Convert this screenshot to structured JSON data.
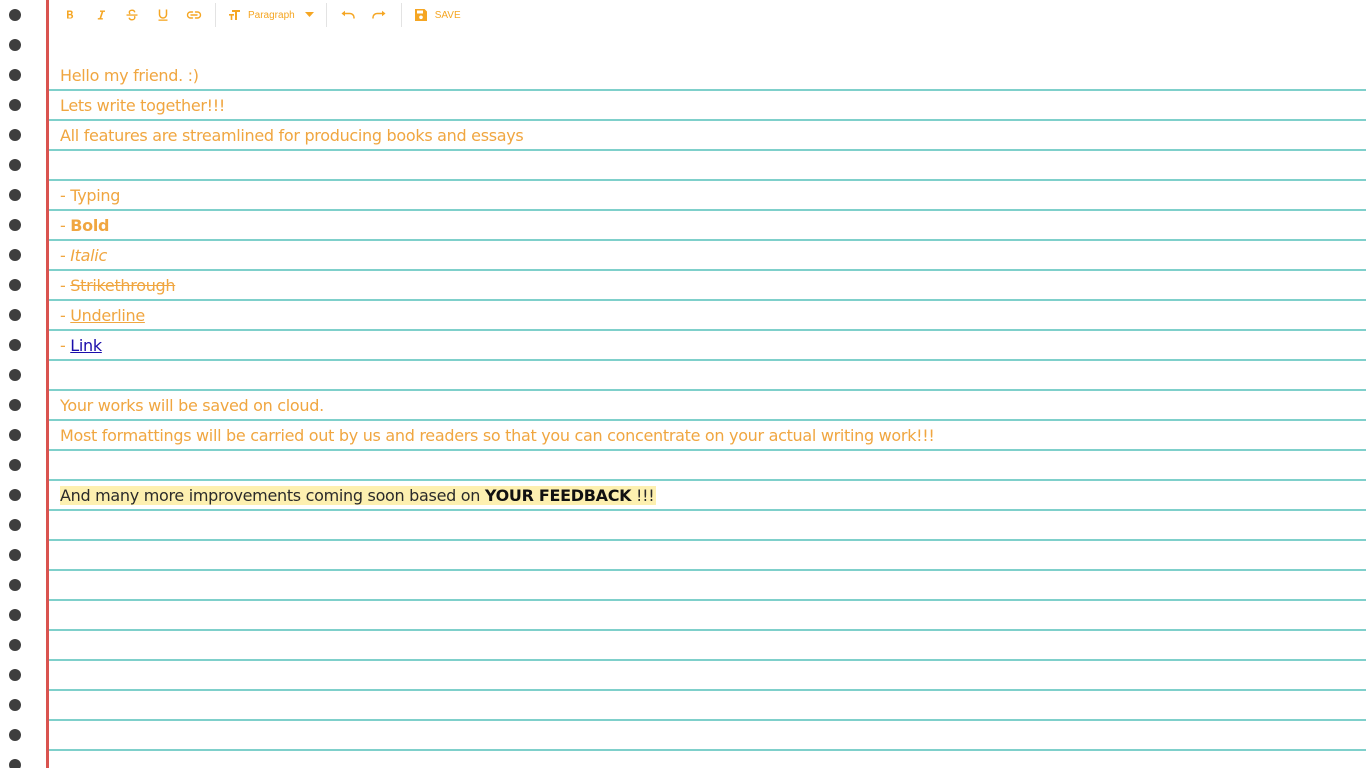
{
  "colors": {
    "accent": "#f5a623",
    "text": "#f0a640",
    "rule": "#7fd0cb",
    "margin": "#d9534f",
    "hole": "#3e3e3e",
    "highlight": "#fdf0b0",
    "link": "#1a0dab"
  },
  "toolbar": {
    "bold_icon": "bold-icon",
    "italic_icon": "italic-icon",
    "strike_icon": "strikethrough-icon",
    "underline_icon": "underline-icon",
    "link_icon": "link-icon",
    "paragraph_label": "Paragraph",
    "undo_icon": "undo-icon",
    "redo_icon": "redo-icon",
    "save_label": "SAVE"
  },
  "document": {
    "line1": "Hello my friend. :)",
    "line2": "Lets write together!!!",
    "line3": "All features are streamlined for producing books and essays",
    "dash": "- ",
    "typing": "Typing",
    "bold": "Bold",
    "italic": "Italic",
    "strike": "Strikethrough",
    "underline": "Underline",
    "link": "Link",
    "cloud": "Your works will be saved on cloud.",
    "formatting": "Most formattings will be carried out by us and readers so that you can concentrate on your actual writing work!!!",
    "improve_prefix": "And many more improvements coming soon based on ",
    "improve_feedback": "YOUR FEEDBACK",
    "improve_suffix": " !!!"
  }
}
